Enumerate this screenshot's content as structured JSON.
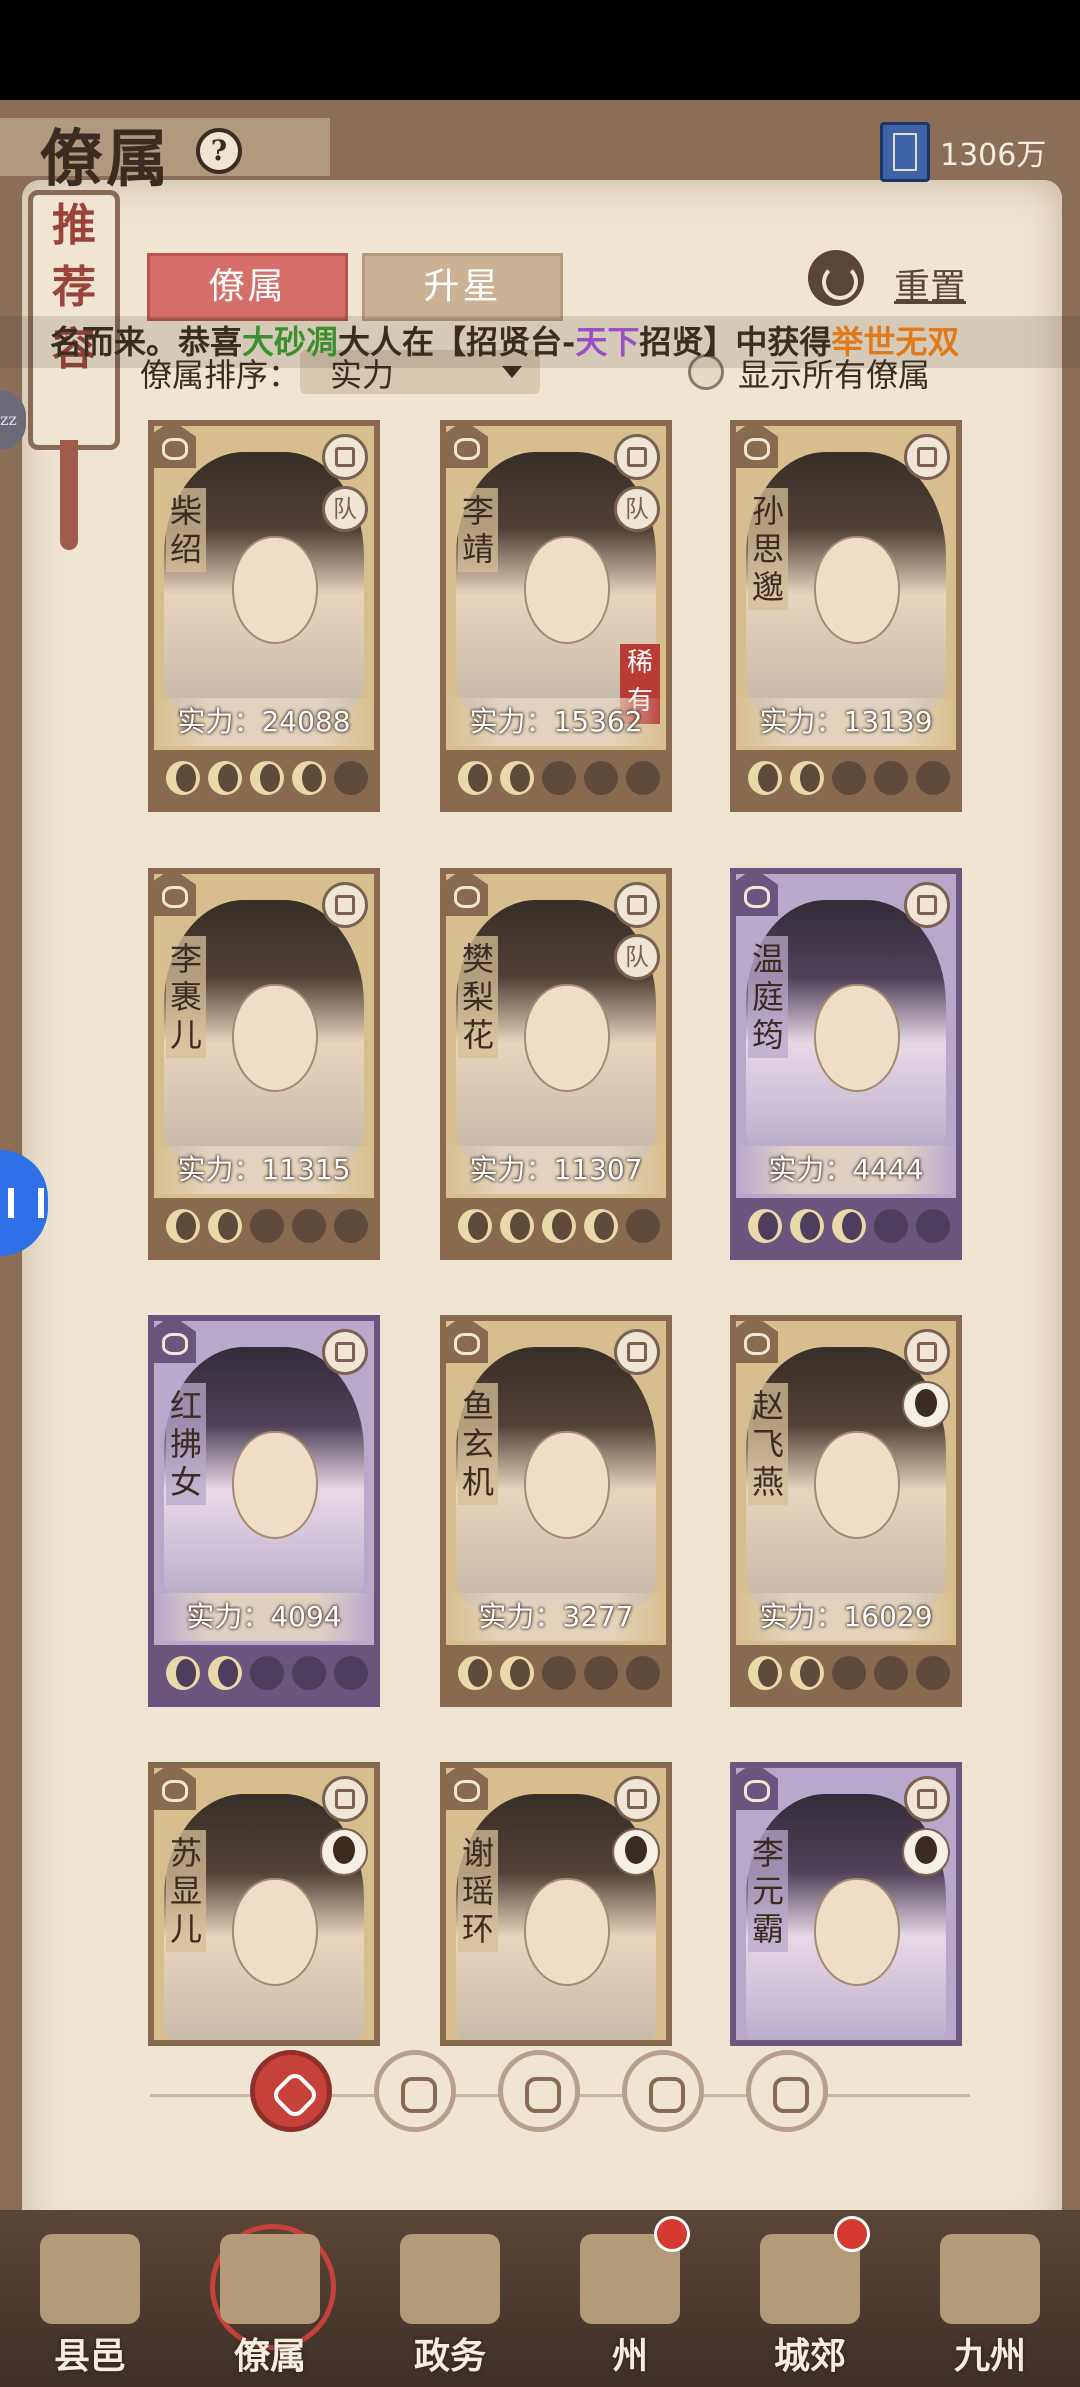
{
  "header": {
    "title": "僚属",
    "help_icon": "question-icon",
    "currency_value": "1306万"
  },
  "bookmark_text": [
    "推",
    "荐",
    "容"
  ],
  "tabs": [
    {
      "label": "僚属",
      "active": true
    },
    {
      "label": "升星",
      "active": false
    }
  ],
  "reset_label": "重置",
  "marquee": {
    "part1": "名而来。恭喜",
    "player": "大砂凋",
    "part2": "大人在【招贤台-",
    "event": "天下",
    "part3": "招贤】中获得",
    "item": "举世无双"
  },
  "sort": {
    "label": "僚属排序：",
    "value": "实力",
    "show_all_label": "显示所有僚属"
  },
  "cards": [
    {
      "name": "柴绍",
      "power_label": "实力：24088",
      "stars": 4,
      "purple": false,
      "team": "队",
      "rare": ""
    },
    {
      "name": "李靖",
      "power_label": "实力：15362",
      "stars": 2,
      "purple": false,
      "team": "队",
      "rare": "稀有"
    },
    {
      "name": "孙思邈",
      "power_label": "实力：13139",
      "stars": 2,
      "purple": false,
      "team": "",
      "rare": ""
    },
    {
      "name": "李裹儿",
      "power_label": "实力：11315",
      "stars": 2,
      "purple": false,
      "team": "",
      "rare": ""
    },
    {
      "name": "樊梨花",
      "power_label": "实力：11307",
      "stars": 4,
      "purple": false,
      "team": "队",
      "rare": ""
    },
    {
      "name": "温庭筠",
      "power_label": "实力：4444",
      "stars": 3,
      "purple": true,
      "team": "",
      "rare": ""
    },
    {
      "name": "红拂女",
      "power_label": "实力：4094",
      "stars": 2,
      "purple": true,
      "team": "",
      "rare": ""
    },
    {
      "name": "鱼玄机",
      "power_label": "实力：3277",
      "stars": 2,
      "purple": false,
      "team": "",
      "rare": ""
    },
    {
      "name": "赵飞燕",
      "power_label": "实力：16029",
      "stars": 2,
      "purple": false,
      "team": "",
      "rare": ""
    },
    {
      "name": "苏显儿",
      "power_label": "",
      "stars": 0,
      "purple": false,
      "team": "",
      "rare": ""
    },
    {
      "name": "谢瑶环",
      "power_label": "",
      "stars": 0,
      "purple": false,
      "team": "",
      "rare": ""
    },
    {
      "name": "李元霸",
      "power_label": "",
      "stars": 0,
      "purple": true,
      "team": "",
      "rare": ""
    }
  ],
  "filters": [
    "all-filter",
    "class-filter-1",
    "class-filter-2",
    "class-filter-3",
    "class-filter-4"
  ],
  "bottom_nav": [
    {
      "label": "县邑",
      "active": false,
      "dot": false
    },
    {
      "label": "僚属",
      "active": true,
      "dot": false
    },
    {
      "label": "政务",
      "active": false,
      "dot": false
    },
    {
      "label": "州",
      "active": false,
      "dot": true
    },
    {
      "label": "城郊",
      "active": false,
      "dot": true
    },
    {
      "label": "九州",
      "active": false,
      "dot": false
    }
  ]
}
